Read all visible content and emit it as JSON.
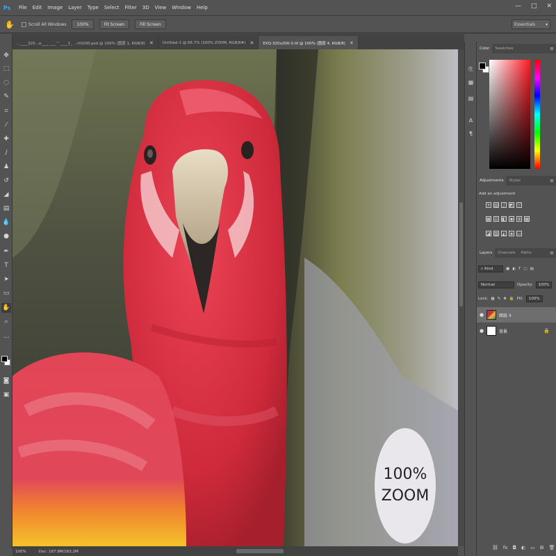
{
  "app": {
    "logo": "Ps"
  },
  "menu": [
    "File",
    "Edit",
    "Image",
    "Layer",
    "Type",
    "Select",
    "Filter",
    "3D",
    "View",
    "Window",
    "Help"
  ],
  "window_controls": {
    "minimize": "—",
    "maximize": "□",
    "close": "✕"
  },
  "options_bar": {
    "tool_icon": "hand-icon",
    "scroll_all_windows_label": "Scroll All Windows",
    "buttons": [
      "100%",
      "Fit Screen",
      "Fill Screen"
    ],
    "workspace": "Essentials"
  },
  "tabs": [
    {
      "label": "...____325...e____ ___' ' ____1_ ...rt0200.psd @ 100% (图层 1, RGB/8)",
      "close": "✕",
      "active": false
    },
    {
      "label": "Untitled-1 @ 66.7% (100% ZOOM, RGB/8#)",
      "close": "✕",
      "active": false
    },
    {
      "label": "EXQ-320x200-3.tif @ 100% (图层 4, RGB/8)",
      "close": "✕",
      "active": true
    }
  ],
  "canvas": {
    "zoom_badge_line1": "100%",
    "zoom_badge_line2": "ZOOM"
  },
  "status": {
    "zoom": "100%",
    "doc": "Doc: 167.9M/163.2M"
  },
  "color_panel": {
    "tabs": [
      "Color",
      "Swatches"
    ],
    "accent": "#ff1a24"
  },
  "adjustments_panel": {
    "tabs": [
      "Adjustments",
      "Styles"
    ],
    "title": "Add an adjustment"
  },
  "layers_panel": {
    "tabs": [
      "Layers",
      "Channels",
      "Paths"
    ],
    "filter_kind": "Kind",
    "blend_mode": "Normal",
    "opacity_label": "Opacity:",
    "opacity_value": "100%",
    "lock_label": "Lock:",
    "fill_label": "Fill:",
    "fill_value": "100%",
    "layers": [
      {
        "name": "图层 4",
        "thumb": "photo",
        "active": true
      },
      {
        "name": "背景",
        "thumb": "white",
        "active": false
      }
    ]
  }
}
